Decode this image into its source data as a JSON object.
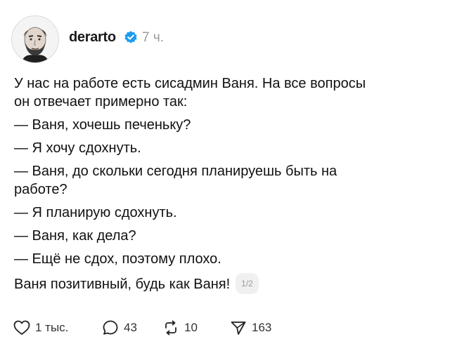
{
  "post": {
    "username": "derarto",
    "time": "7 ч.",
    "lines": [
      "У нас на работе есть сисадмин Ваня. На все вопросы",
      "он отвечает примерно так:",
      "— Ваня, хочешь печеньку?",
      "— Я хочу сдохнуть.",
      "— Ваня, до скольки сегодня планируешь быть на",
      "работе?",
      "— Я планирую сдохнуть.",
      "— Ваня, как дела?",
      "— Ещё не сдох, поэтому плохо.",
      "Ваня позитивный, будь как Ваня!"
    ],
    "page_indicator": "1/2"
  },
  "actions": {
    "likes": "1 тыс.",
    "replies": "43",
    "reposts": "10",
    "shares": "163"
  },
  "icons": {
    "avatar": "avatar",
    "verified": "verified-badge-icon",
    "like": "heart-icon",
    "reply": "comment-icon",
    "repost": "repost-icon",
    "share": "send-icon"
  },
  "colors": {
    "verified": "#1d9bf0",
    "muted": "#9a9a9a",
    "text": "#111111"
  }
}
